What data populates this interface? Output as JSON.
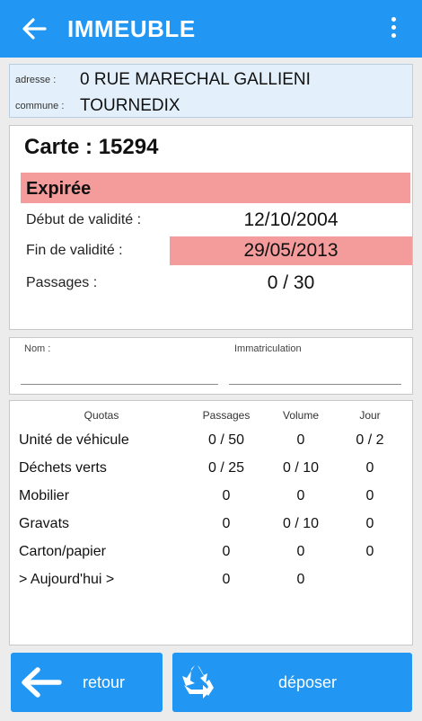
{
  "appbar": {
    "title": "IMMEUBLE"
  },
  "address": {
    "address_label": "adresse :",
    "address_value": "0 RUE MARECHAL GALLIENI",
    "commune_label": "commune :",
    "commune_value": "TOURNEDIX"
  },
  "card": {
    "title": "Carte : 15294",
    "status": "Expirée",
    "start_label": "Début de validité :",
    "start_value": "12/10/2004",
    "end_label": "Fin de validité :",
    "end_value": "29/05/2013",
    "passages_label": "Passages :",
    "passages_value": "0 / 30"
  },
  "form": {
    "name_label": "Nom :",
    "name_value": "",
    "plate_label": "Immatriculation",
    "plate_value": ""
  },
  "quotas": {
    "headers": [
      "Quotas",
      "Passages",
      "Volume",
      "Jour"
    ],
    "rows": [
      [
        "Unité de véhicule",
        "0 / 50",
        "0",
        "0 / 2"
      ],
      [
        "Déchets verts",
        "0 / 25",
        "0 / 10",
        "0"
      ],
      [
        "Mobilier",
        "0",
        "0",
        "0"
      ],
      [
        "Gravats",
        "0",
        "0 / 10",
        "0"
      ],
      [
        "Carton/papier",
        "0",
        "0",
        "0"
      ],
      [
        "> Aujourd'hui >",
        "0",
        "0",
        ""
      ]
    ]
  },
  "buttons": {
    "back_label": "retour",
    "deposit_label": "déposer"
  },
  "colors": {
    "primary": "#2196f3",
    "expired": "#f49b9b",
    "address_bg": "#e3f0fb"
  }
}
